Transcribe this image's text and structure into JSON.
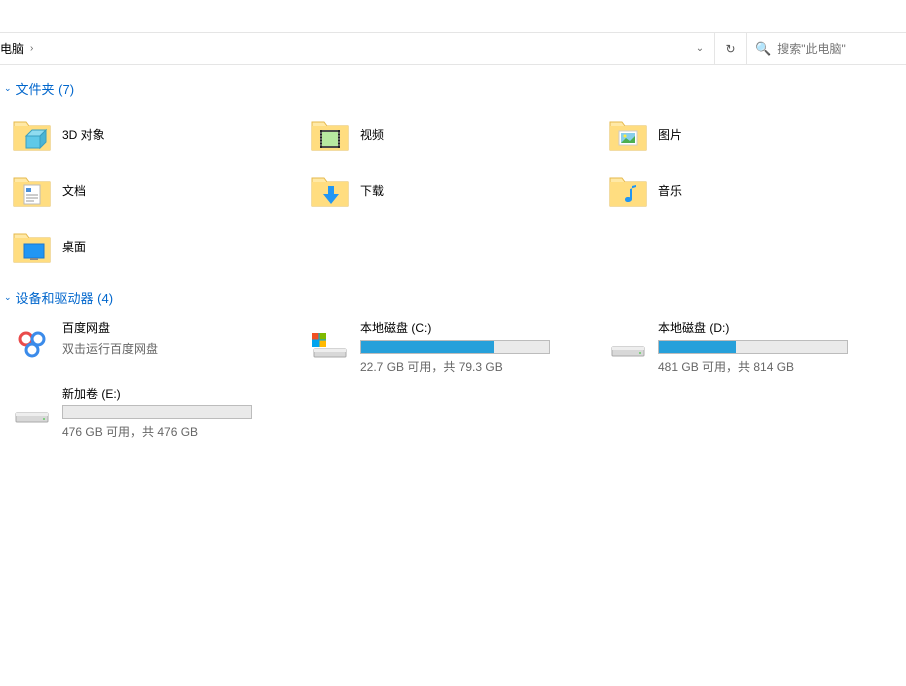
{
  "breadcrumb": {
    "location": "电脑"
  },
  "search": {
    "placeholder": "搜索\"此电脑\""
  },
  "sections": {
    "folders": {
      "title": "文件夹 (7)",
      "items": [
        {
          "label": "3D 对象"
        },
        {
          "label": "视频"
        },
        {
          "label": "图片"
        },
        {
          "label": "文档"
        },
        {
          "label": "下载"
        },
        {
          "label": "音乐"
        },
        {
          "label": "桌面"
        }
      ]
    },
    "drives": {
      "title": "设备和驱动器 (4)",
      "items": [
        {
          "name": "百度网盘",
          "subtitle": "双击运行百度网盘",
          "type": "app"
        },
        {
          "name": "本地磁盘 (C:)",
          "stats": "22.7 GB 可用，共 79.3 GB",
          "fill_percent": 71,
          "type": "system"
        },
        {
          "name": "本地磁盘 (D:)",
          "stats": "481 GB 可用，共 814 GB",
          "fill_percent": 41,
          "type": "disk"
        },
        {
          "name": "新加卷 (E:)",
          "stats": "476 GB 可用，共 476 GB",
          "fill_percent": 0,
          "type": "disk"
        }
      ]
    }
  }
}
